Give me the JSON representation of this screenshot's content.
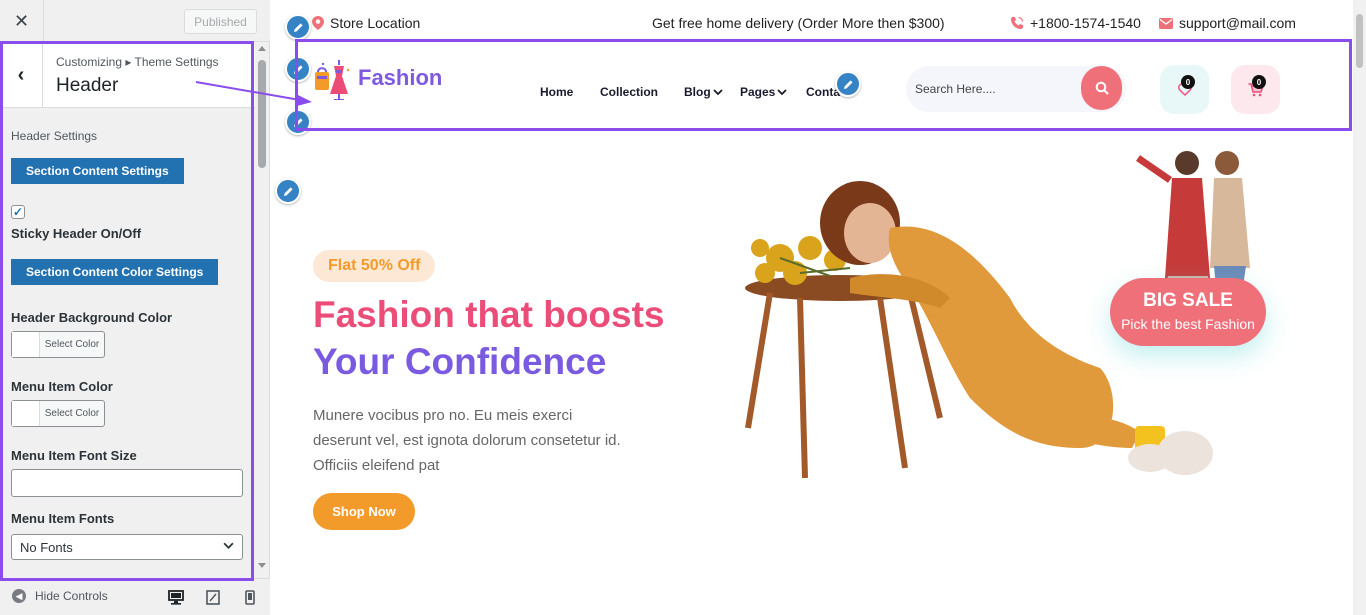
{
  "sidebar": {
    "close_icon": "close-icon",
    "published_label": "Published",
    "breadcrumb": "Customizing ▸ Theme Settings",
    "panel_title": "Header",
    "section_heading": "Header Settings",
    "content_settings_button": "Section Content Settings",
    "sticky_label": "Sticky Header On/Off",
    "sticky_checked": true,
    "color_settings_button": "Section Content Color Settings",
    "bg_color_label": "Header Background Color",
    "bg_color_button": "Select Color",
    "menu_color_label": "Menu Item Color",
    "menu_color_button": "Select Color",
    "font_size_label": "Menu Item Font Size",
    "font_size_value": "",
    "fonts_label": "Menu Item Fonts",
    "fonts_value": "No Fonts",
    "hide_controls": "Hide Controls",
    "accent_color": "#2271b1"
  },
  "topbar": {
    "store_location": "Store Location",
    "promo": "Get free home delivery (Order More then $300)",
    "phone": "+1800-1574-1540",
    "email": "support@mail.com"
  },
  "header": {
    "logo_text": "Fashion",
    "nav": {
      "home": "Home",
      "collection": "Collection",
      "blog": "Blog",
      "pages": "Pages",
      "contact": "Conta"
    },
    "search_placeholder": "Search Here....",
    "wishlist_count": "0",
    "cart_count": "0"
  },
  "hero": {
    "badge": "Flat 50% Off",
    "headline_1": "Fashion that boosts",
    "headline_2": "Your Confidence",
    "description": "Munere vocibus pro no. Eu meis exerci deserunt vel, est ignota dolorum consetetur id. Officiis eleifend pat",
    "cta": "Shop Now",
    "sale_title": "BIG SALE",
    "sale_subtitle": "Pick the best Fashion"
  },
  "colors": {
    "highlight": "#8a4dec",
    "pink": "#ec4c78",
    "purple": "#7a5ae0",
    "orange": "#f39b2a",
    "coral": "#f0707a"
  }
}
